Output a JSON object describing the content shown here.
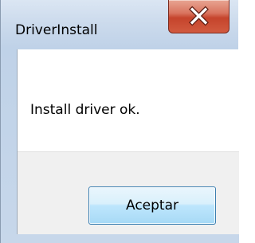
{
  "window": {
    "title": "DriverInstall"
  },
  "dialog": {
    "message": "Install driver ok.",
    "ok_label": "Aceptar"
  },
  "icons": {
    "close": "close-icon"
  },
  "colors": {
    "close_button": "#c5442c",
    "ok_button_border": "#3c7fb1"
  }
}
